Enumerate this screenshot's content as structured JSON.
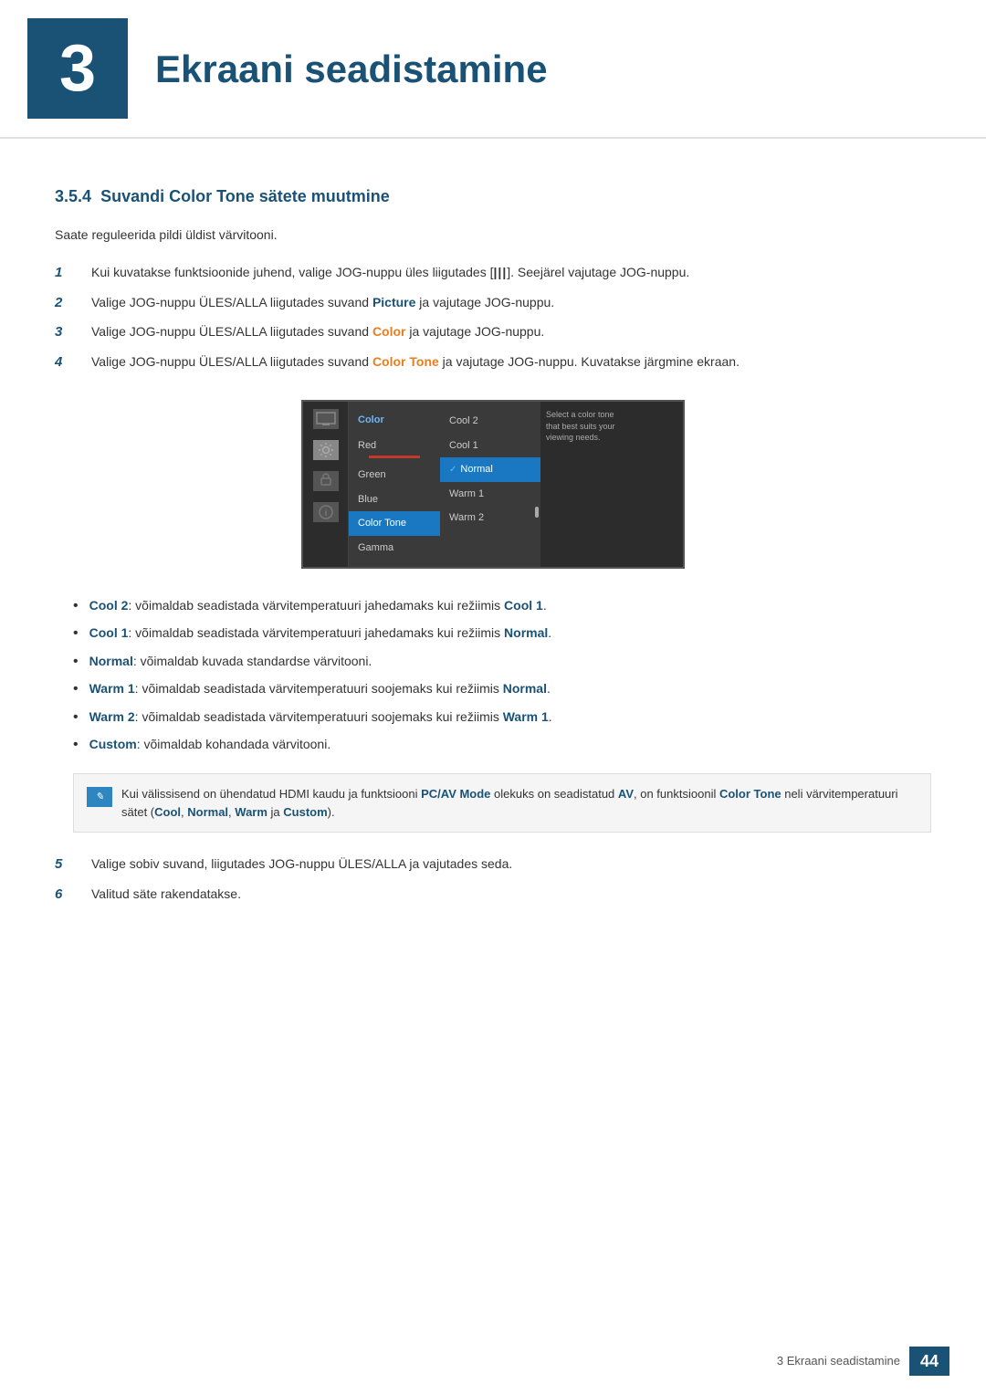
{
  "header": {
    "chapter_number": "3",
    "chapter_title": "Ekraani seadistamine"
  },
  "section": {
    "number": "3.5.4",
    "title": "Suvandi Color Tone sätete muutmine"
  },
  "intro": "Saate reguleerida pildi üldist värvitooni.",
  "steps": [
    {
      "number": "1",
      "text_plain": "Kui kuvatakse funktsioonide juhend, valige JOG-nuppu üles liigutades [",
      "icon": "|||",
      "text_plain2": "]. Seejärel vajutage JOG-nuppu."
    },
    {
      "number": "2",
      "text": "Valige JOG-nuppu ÜLES/ALLA liigutades suvand",
      "bold_word": "Picture",
      "text2": "ja vajutage JOG-nuppu."
    },
    {
      "number": "3",
      "text": "Valige JOG-nuppu ÜLES/ALLA liigutades suvand",
      "bold_word": "Color",
      "text2": "ja vajutage JOG-nuppu."
    },
    {
      "number": "4",
      "text": "Valige JOG-nuppu ÜLES/ALLA liigutades suvand",
      "bold_word": "Color Tone",
      "text2": "ja vajutage JOG-nuppu. Kuvatakse järgmine ekraan."
    }
  ],
  "screen": {
    "menu_header": "Color",
    "menu_items": [
      "Red",
      "Green",
      "Blue",
      "Color Tone",
      "Gamma"
    ],
    "menu_highlighted": "Color Tone",
    "submenu_items": [
      "Cool 2",
      "Cool 1",
      "Normal",
      "Warm 1",
      "Warm 2"
    ],
    "submenu_selected": "Normal",
    "help_text": "Select a color tone that best suits your viewing needs."
  },
  "bullets": [
    {
      "bold": "Cool 2",
      "text": ": võimaldab seadistada värvitemperatuuri jahedamaks kui režiimis",
      "bold2": "Cool 1",
      "text2": "."
    },
    {
      "bold": "Cool 1",
      "text": ": võimaldab seadistada värvitemperatuuri jahedamaks kui režiimis",
      "bold2": "Normal",
      "text2": "."
    },
    {
      "bold": "Normal",
      "text": ": võimaldab kuvada standardse värvitooni.",
      "bold2": "",
      "text2": ""
    },
    {
      "bold": "Warm 1",
      "text": ": võimaldab seadistada värvitemperatuuri soojemaks kui režiimis",
      "bold2": "Normal",
      "text2": "."
    },
    {
      "bold": "Warm 2",
      "text": ": võimaldab seadistada värvitemperatuuri soojemaks kui režiimis",
      "bold2": "Warm 1",
      "text2": "."
    },
    {
      "bold": "Custom",
      "text": ": võimaldab kohandada värvitooni.",
      "bold2": "",
      "text2": ""
    }
  ],
  "note": {
    "text_plain": "Kui välissisend on ühendatud HDMI kaudu ja funktsiooni",
    "bold1": "PC/AV Mode",
    "text2": "olekuks on seadistatud",
    "bold2": "AV",
    "text3": ", on funktsioonil",
    "bold3": "Color Tone",
    "text4": "neli värvitemperatuuri sätet (",
    "bold4": "Cool",
    "text5": ",",
    "bold5": "Normal",
    "text6": ",",
    "bold6": "Warm",
    "text7": "ja",
    "bold7": "Custom",
    "text8": ")."
  },
  "steps_after": [
    {
      "number": "5",
      "text": "Valige sobiv suvand, liigutades JOG-nuppu ÜLES/ALLA ja vajutades seda."
    },
    {
      "number": "6",
      "text": "Valitud säte rakendatakse."
    }
  ],
  "footer": {
    "text": "3 Ekraani seadistamine",
    "page": "44"
  }
}
